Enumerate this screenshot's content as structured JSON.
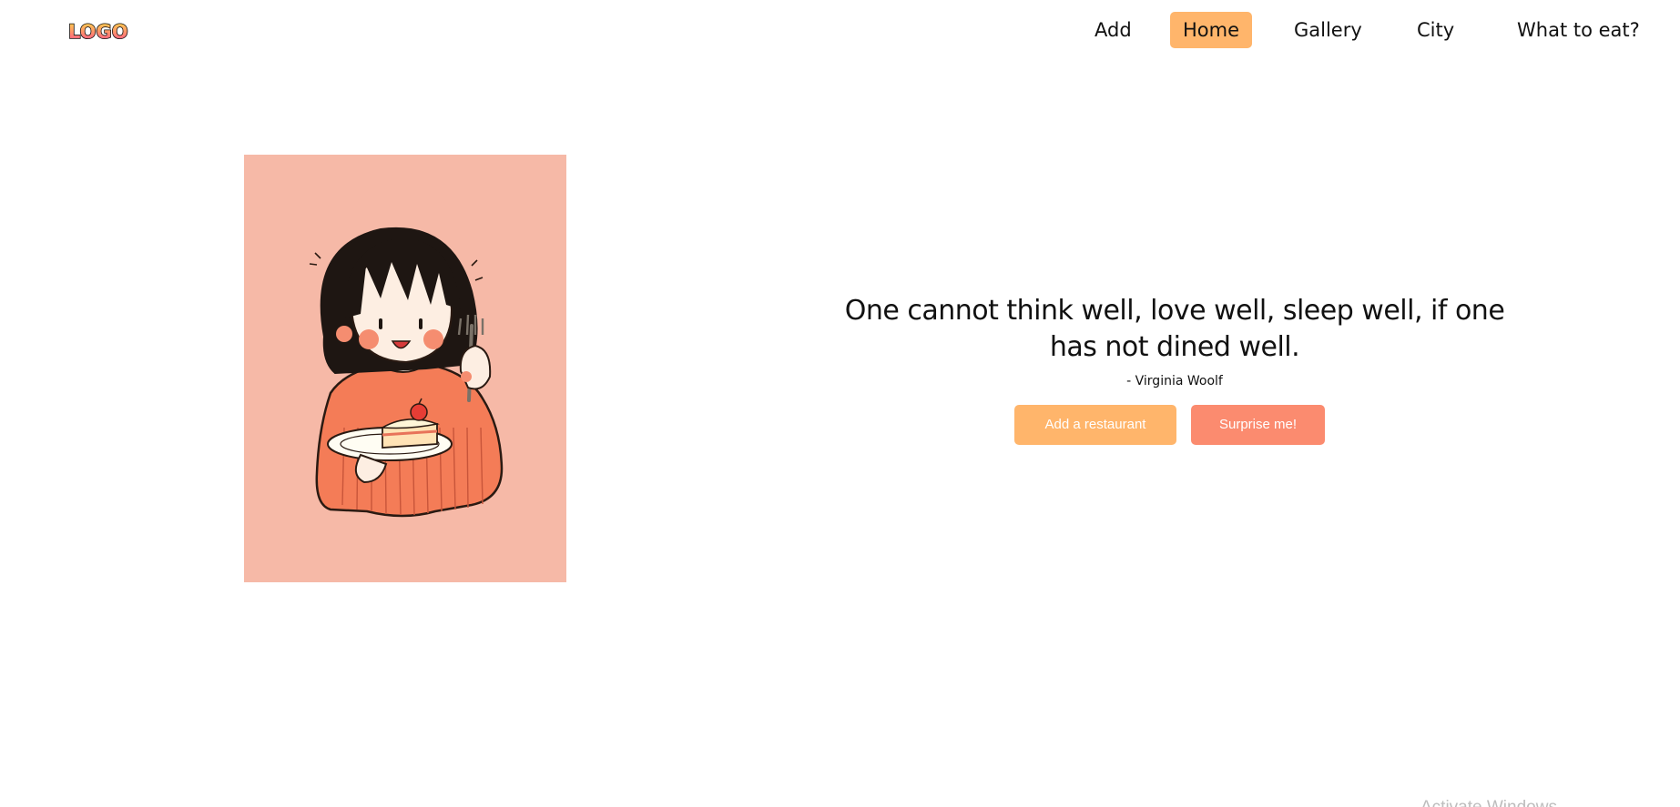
{
  "header": {
    "logo_text": "LOGO",
    "nav": [
      {
        "label": "Add",
        "active": false
      },
      {
        "label": "Home",
        "active": true
      },
      {
        "label": "Gallery",
        "active": false
      },
      {
        "label": "City",
        "active": false
      },
      {
        "label": "What to eat?",
        "active": false
      }
    ]
  },
  "hero": {
    "quote": "One cannot think well, love well, sleep well, if one has not dined well.",
    "author": "- Virginia Woolf",
    "add_button_label": "Add a restaurant",
    "surprise_button_label": "Surprise me!"
  },
  "colors": {
    "accent_orange": "#ffb56b",
    "accent_coral": "#fb8b6f",
    "illustration_bg": "#f6b9a7"
  },
  "os_watermark": "Activate Windows"
}
